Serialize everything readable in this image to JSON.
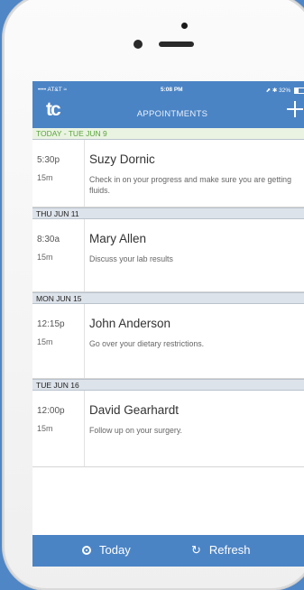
{
  "status_bar": {
    "carrier": "•••• AT&T ≈",
    "time": "5:08 PM",
    "battery": "⬈ ✱ 32%"
  },
  "header": {
    "logo": "tc",
    "title": "APPOINTMENTS",
    "add_icon": "plus-icon"
  },
  "sections": [
    {
      "label": "TODAY - TUE JUN 9",
      "appointments": [
        {
          "time": "5:30p",
          "duration": "15m",
          "name": "Suzy Dornic",
          "note": "Check in on your progress and make sure you are getting fluids."
        }
      ]
    },
    {
      "label": "THU JUN 11",
      "appointments": [
        {
          "time": "8:30a",
          "duration": "15m",
          "name": "Mary Allen",
          "note": "Discuss your lab results"
        }
      ]
    },
    {
      "label": "MON JUN 15",
      "appointments": [
        {
          "time": "12:15p",
          "duration": "15m",
          "name": "John Anderson",
          "note": "Go over your dietary restrictions."
        }
      ]
    },
    {
      "label": "TUE JUN 16",
      "appointments": [
        {
          "time": "12:00p",
          "duration": "15m",
          "name": "David Gearhardt",
          "note": "Follow up on your surgery."
        }
      ]
    }
  ],
  "footer": {
    "today_label": "Today",
    "refresh_label": "Refresh"
  },
  "colors": {
    "accent": "#4b84c5",
    "today_green": "#5aa43a"
  }
}
